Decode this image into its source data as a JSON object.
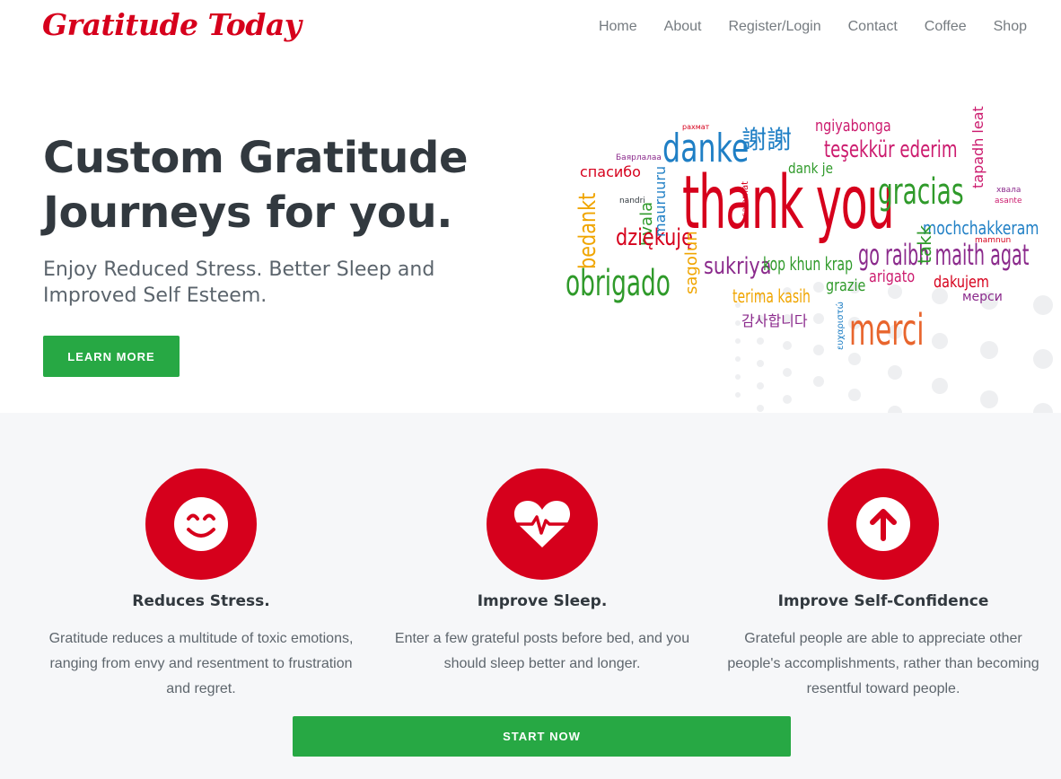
{
  "brand": {
    "logo_text": "Gratitude Today",
    "accent": "#d6001c",
    "button_green": "#27a844"
  },
  "nav": {
    "items": [
      {
        "label": "Home"
      },
      {
        "label": "About"
      },
      {
        "label": "Register/Login"
      },
      {
        "label": "Contact"
      },
      {
        "label": "Coffee"
      },
      {
        "label": "Shop"
      }
    ]
  },
  "hero": {
    "title": "Custom Gratitude Journeys for you.",
    "subtitle": "Enjoy Reduced Stress. Better Sleep and Improved Self Esteem.",
    "cta_label": "LEARN MORE"
  },
  "word_cloud": {
    "words": [
      "danke",
      "謝謝",
      "ngiyabonga",
      "teşekkür ederim",
      "спасибо",
      "thank you",
      "gracias",
      "tapadh leat",
      "bedankt",
      "hvala",
      "dziękuję",
      "mochchakkeram",
      "go raibh maith agat",
      "obrigado",
      "sukriya",
      "kop khun krap",
      "arigato",
      "takk",
      "dakujem",
      "мерси",
      "terima kasih",
      "grazie",
      "merci",
      "감사합니다",
      "sagolun",
      "mauruuru",
      "ευχαριστώ",
      "dank je",
      "salamat",
      "asante",
      "nandri",
      "Баярлалаа",
      "рахмат",
      "хвала",
      "mamnun"
    ]
  },
  "features": [
    {
      "icon": "smile-icon",
      "title": "Reduces Stress.",
      "text": "Gratitude reduces a multitude of toxic emotions, ranging from envy and resentment to frustration and regret."
    },
    {
      "icon": "heartbeat-icon",
      "title": "Improve Sleep.",
      "text": "Enter a few grateful posts before bed, and you should sleep better and longer."
    },
    {
      "icon": "arrow-up-icon",
      "title": "Improve Self-Confidence",
      "text": "Grateful people are able to appreciate other people's accomplishments, rather than becoming resentful toward people."
    }
  ],
  "start_label": "START NOW"
}
